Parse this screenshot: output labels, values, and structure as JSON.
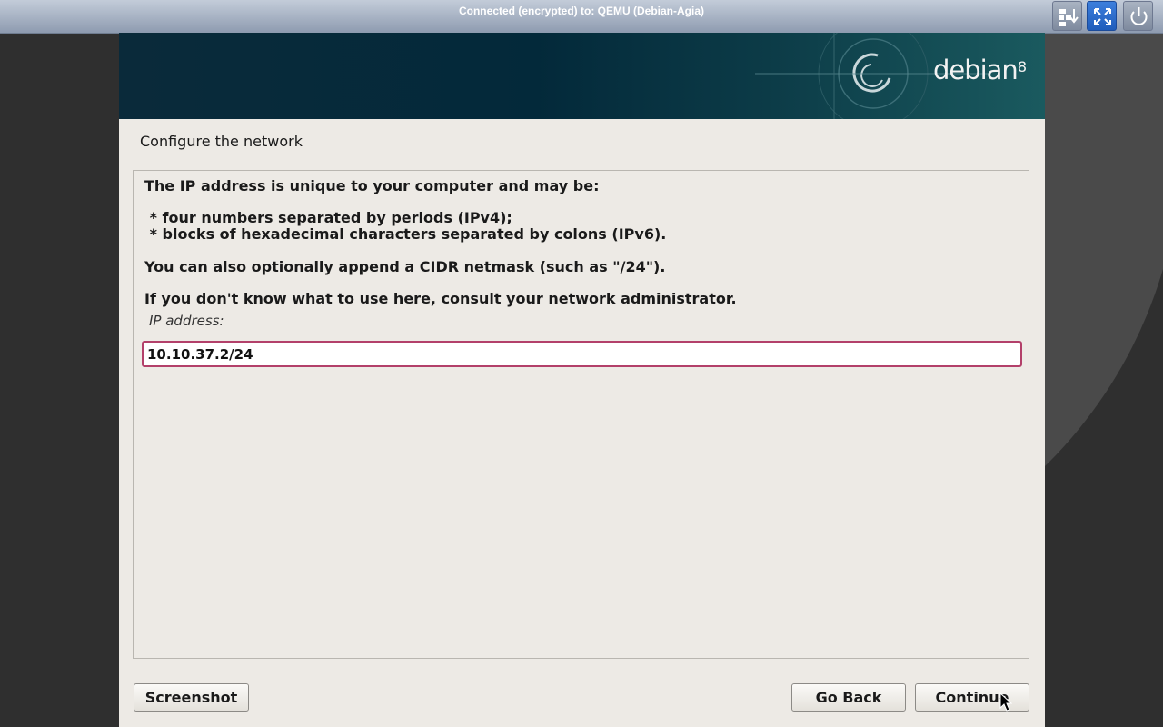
{
  "viewer": {
    "title": "Connected (encrypted) to: QEMU (Debian-Agia)",
    "buttons": [
      {
        "name": "send-keys-icon"
      },
      {
        "name": "fullscreen-icon"
      },
      {
        "name": "power-icon"
      }
    ]
  },
  "installer": {
    "brand": "debian",
    "brand_version": "8",
    "page_title": "Configure the network",
    "paragraphs": {
      "p1": "The IP address is unique to your computer and may be:",
      "b1": " * four numbers separated by periods (IPv4);",
      "b2": " * blocks of hexadecimal characters separated by colons (IPv6).",
      "p2": "You can also optionally append a CIDR netmask (such as \"/24\").",
      "p3": "If you don't know what to use here, consult your network administrator."
    },
    "field": {
      "label": "IP address:",
      "value": "10.10.37.2/24"
    },
    "buttons": {
      "screenshot": "Screenshot",
      "go_back": "Go Back",
      "continue": "Continue"
    }
  },
  "colors": {
    "input_border": "#b3406a",
    "window_bg": "#edeae5",
    "banner": "#03293a"
  }
}
